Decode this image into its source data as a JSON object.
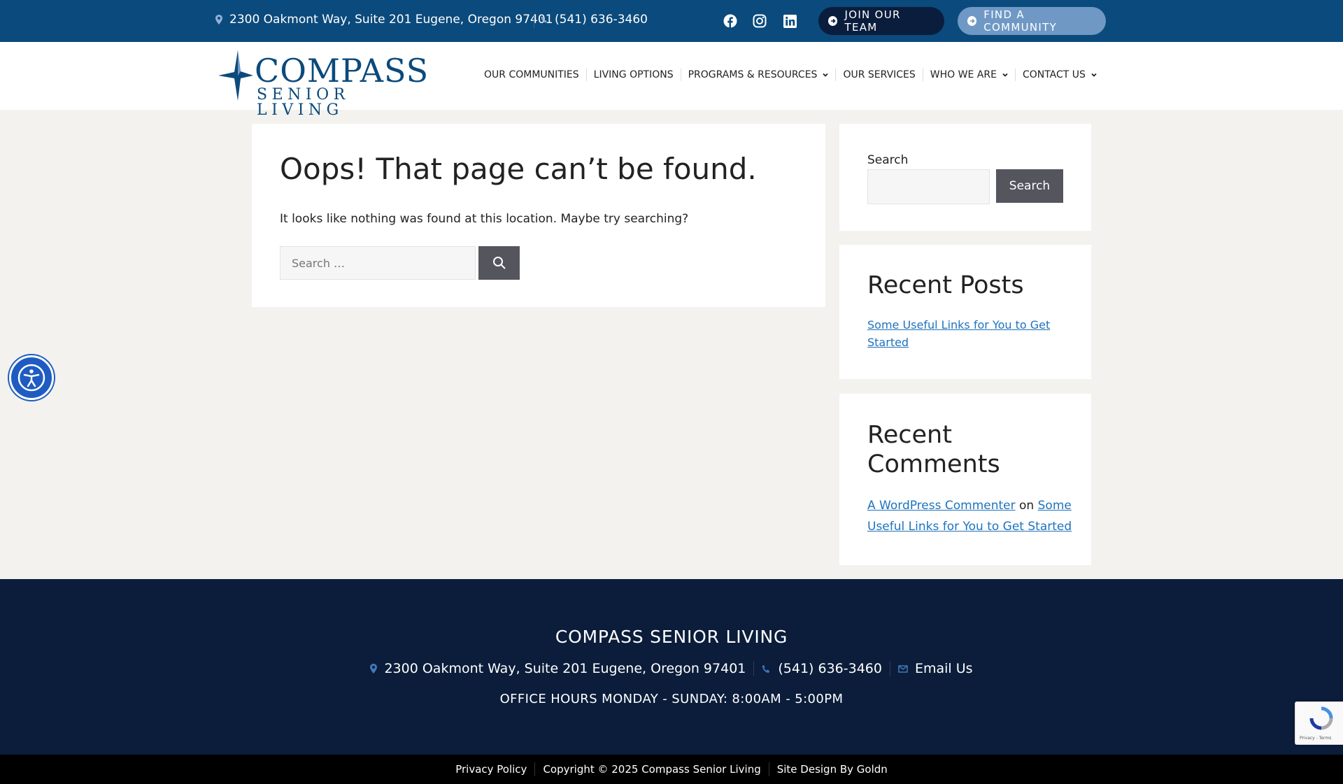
{
  "topbar": {
    "address": "2300 Oakmont Way, Suite 201 Eugene, Oregon 97401",
    "phone": "(541) 636-3460",
    "social_icons": [
      "facebook-icon",
      "instagram-icon",
      "linkedin-icon"
    ],
    "join_label": "JOIN OUR TEAM",
    "find_label": "FIND A COMMUNITY"
  },
  "logo": {
    "line1": "COMPASS",
    "line2": "SENIOR LIVING"
  },
  "nav": {
    "items": [
      {
        "label": "OUR COMMUNITIES",
        "dropdown": false
      },
      {
        "label": "LIVING OPTIONS",
        "dropdown": false
      },
      {
        "label": "PROGRAMS & RESOURCES",
        "dropdown": true
      },
      {
        "label": "OUR SERVICES",
        "dropdown": false
      },
      {
        "label": "WHO WE ARE",
        "dropdown": true
      },
      {
        "label": "CONTACT US",
        "dropdown": true
      }
    ]
  },
  "main": {
    "title": "Oops! That page can’t be found.",
    "message": "It looks like nothing was found at this location. Maybe try searching?",
    "search_placeholder": "Search …"
  },
  "sidebar": {
    "search_label": "Search",
    "search_button": "Search",
    "recent_posts_title": "Recent Posts",
    "recent_post_link": "Some Useful Links for You to Get Started",
    "recent_comments_title": "Recent Comments",
    "comment_author": "A WordPress Commenter",
    "comment_on": "on",
    "comment_post": "Some Useful Links for You to Get Started"
  },
  "footer": {
    "title": "COMPASS SENIOR LIVING",
    "address": "2300 Oakmont Way, Suite 201 Eugene, Oregon 97401",
    "phone": "(541) 636-3460",
    "email": "Email Us",
    "hours": "OFFICE HOURS MONDAY - SUNDAY: 8:00AM - 5:00PM"
  },
  "bottom": {
    "privacy": "Privacy Policy",
    "copyright": "Copyright © 2025 Compass Senior Living",
    "design": "Site Design By Goldn"
  },
  "recaptcha": {
    "text": "Privacy - Terms"
  },
  "colors": {
    "topbar": "#0b4a7c",
    "footer": "#0b1d3a",
    "link": "#1e73be",
    "accent_button": "#6f98c5"
  }
}
